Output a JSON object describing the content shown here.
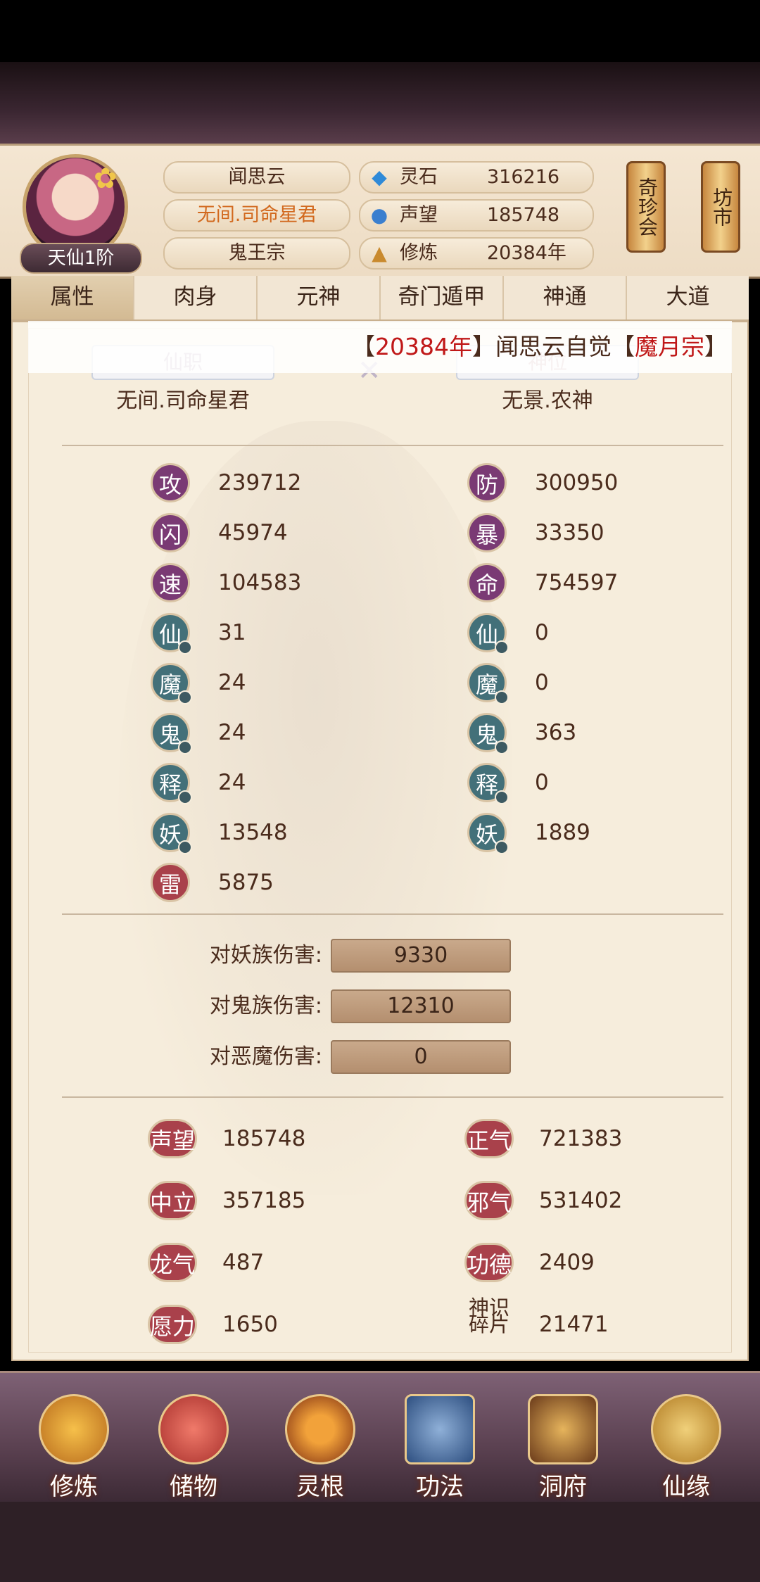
{
  "header": {
    "rank": "天仙1阶",
    "name": "闻思云",
    "title": "无间.司命星君",
    "sect": "鬼王宗",
    "resources": [
      {
        "icon": "spirit-stone-icon",
        "label": "灵石",
        "value": "316216"
      },
      {
        "icon": "reputation-icon",
        "label": "声望",
        "value": "185748"
      },
      {
        "icon": "cultivation-icon",
        "label": "修炼",
        "value": "20384年"
      }
    ],
    "side_buttons": [
      "奇珍会",
      "坊市"
    ]
  },
  "tabs": [
    "属性",
    "肉身",
    "元神",
    "奇门遁甲",
    "神通",
    "大道"
  ],
  "marquee": {
    "open": "【",
    "year": "20384年",
    "close": "】",
    "mid": "闻思云自觉",
    "open2": "【",
    "sect": "魔月宗",
    "close2": "】"
  },
  "titles": {
    "left_banner": "仙职",
    "left_value": "无间.司命星君",
    "right_banner": "神位",
    "right_value": "无景.农神"
  },
  "stats_left": [
    {
      "icon": "攻",
      "value": "239712",
      "color": "purple"
    },
    {
      "icon": "闪",
      "value": "45974",
      "color": "purple"
    },
    {
      "icon": "速",
      "value": "104583",
      "color": "purple"
    },
    {
      "icon": "仙",
      "value": "31",
      "color": "teal"
    },
    {
      "icon": "魔",
      "value": "24",
      "color": "teal"
    },
    {
      "icon": "鬼",
      "value": "24",
      "color": "teal"
    },
    {
      "icon": "释",
      "value": "24",
      "color": "teal"
    },
    {
      "icon": "妖",
      "value": "13548",
      "color": "teal"
    },
    {
      "icon": "雷",
      "value": "5875",
      "color": "red"
    }
  ],
  "stats_right": [
    {
      "icon": "防",
      "value": "300950",
      "color": "purple"
    },
    {
      "icon": "暴",
      "value": "33350",
      "color": "purple"
    },
    {
      "icon": "命",
      "value": "754597",
      "color": "purple"
    },
    {
      "icon": "仙",
      "value": "0",
      "color": "teal"
    },
    {
      "icon": "魔",
      "value": "0",
      "color": "teal"
    },
    {
      "icon": "鬼",
      "value": "363",
      "color": "teal"
    },
    {
      "icon": "释",
      "value": "0",
      "color": "teal"
    },
    {
      "icon": "妖",
      "value": "1889",
      "color": "teal"
    }
  ],
  "damage": [
    {
      "label": "对妖族伤害:",
      "value": "9330"
    },
    {
      "label": "对鬼族伤害:",
      "value": "12310"
    },
    {
      "label": "对恶魔伤害:",
      "value": "0"
    }
  ],
  "bottom_left": [
    {
      "label": "声望",
      "value": "185748"
    },
    {
      "label": "中立",
      "value": "357185"
    },
    {
      "label": "龙气",
      "value": "487"
    },
    {
      "label": "愿力",
      "value": "1650"
    }
  ],
  "bottom_right": [
    {
      "label": "正气",
      "value": "721383"
    },
    {
      "label": "邪气",
      "value": "531402"
    },
    {
      "label": "功德",
      "value": "2409"
    },
    {
      "label": "神识碎片",
      "value": "21471"
    }
  ],
  "nav": [
    "修炼",
    "储物",
    "灵根",
    "功法",
    "洞府",
    "仙缘"
  ],
  "colors": {
    "purple": "#7a3a74",
    "teal": "#437079",
    "red": "#a9414b",
    "accent_orange": "#d2691e",
    "marquee_red": "#c01818"
  }
}
